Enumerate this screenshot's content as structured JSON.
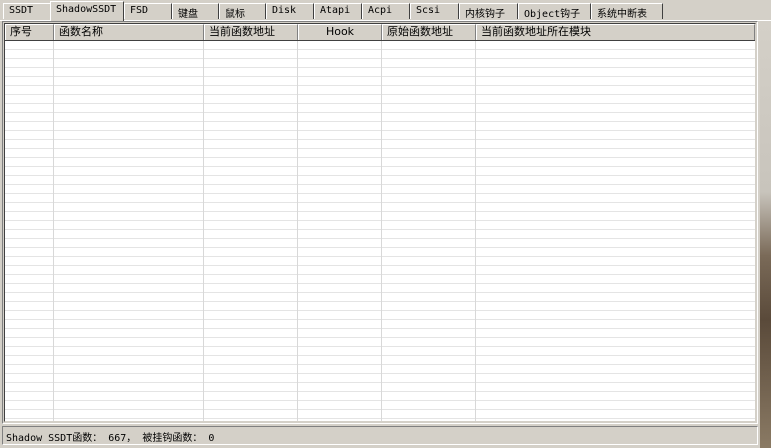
{
  "tabs": [
    {
      "label": "SSDT"
    },
    {
      "label": "ShadowSSDT"
    },
    {
      "label": "FSD"
    },
    {
      "label": "键盘"
    },
    {
      "label": "鼠标"
    },
    {
      "label": "Disk"
    },
    {
      "label": "Atapi"
    },
    {
      "label": "Acpi"
    },
    {
      "label": "Scsi"
    },
    {
      "label": "内核钩子"
    },
    {
      "label": "Object钩子"
    },
    {
      "label": "系统中断表"
    }
  ],
  "active_tab": "ShadowSSDT",
  "table": {
    "columns": [
      {
        "label": "序号"
      },
      {
        "label": "函数名称"
      },
      {
        "label": "当前函数地址"
      },
      {
        "label": "Hook"
      },
      {
        "label": "原始函数地址"
      },
      {
        "label": "当前函数地址所在模块"
      }
    ],
    "rows": []
  },
  "status": {
    "text": "Shadow SSDT函数： 667， 被挂钩函数： 0"
  }
}
